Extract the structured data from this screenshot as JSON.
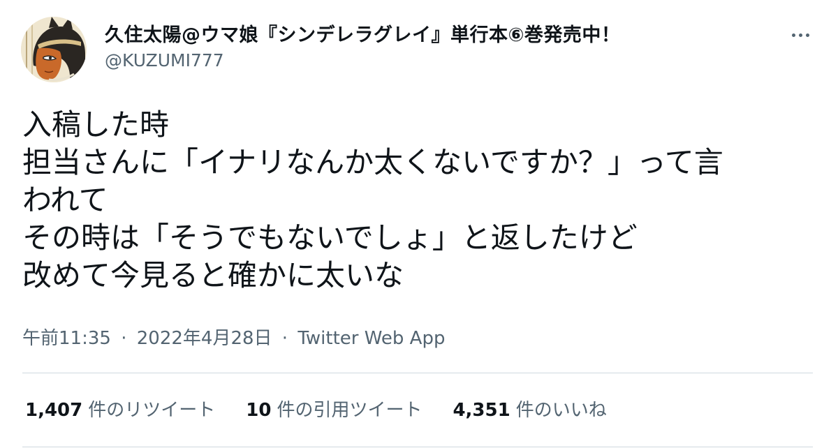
{
  "author": {
    "display_name": "久住太陽@ウマ娘『シンデレラグレイ』単行本⑥巻発売中！",
    "handle": "@KUZUMI777"
  },
  "tweet": {
    "lines": [
      "入稿した時",
      "担当さんに「イナリなんか太くないですか？」って言",
      "われて",
      "その時は「そうでもないでしょ」と返したけど",
      "改めて今見ると確かに太いな"
    ]
  },
  "meta": {
    "time": "午前11:35",
    "date": "2022年4月28日",
    "separator": "·",
    "source": "Twitter Web App"
  },
  "stats": {
    "retweets": {
      "count": "1,407",
      "label": "件のリツイート"
    },
    "quotes": {
      "count": "10",
      "label": "件の引用ツイート"
    },
    "likes": {
      "count": "4,351",
      "label": "件のいいね"
    }
  },
  "icons": {
    "more": "more-icon"
  },
  "colors": {
    "text": "#0f1419",
    "secondary": "#536471",
    "divider": "#cfd9de"
  }
}
